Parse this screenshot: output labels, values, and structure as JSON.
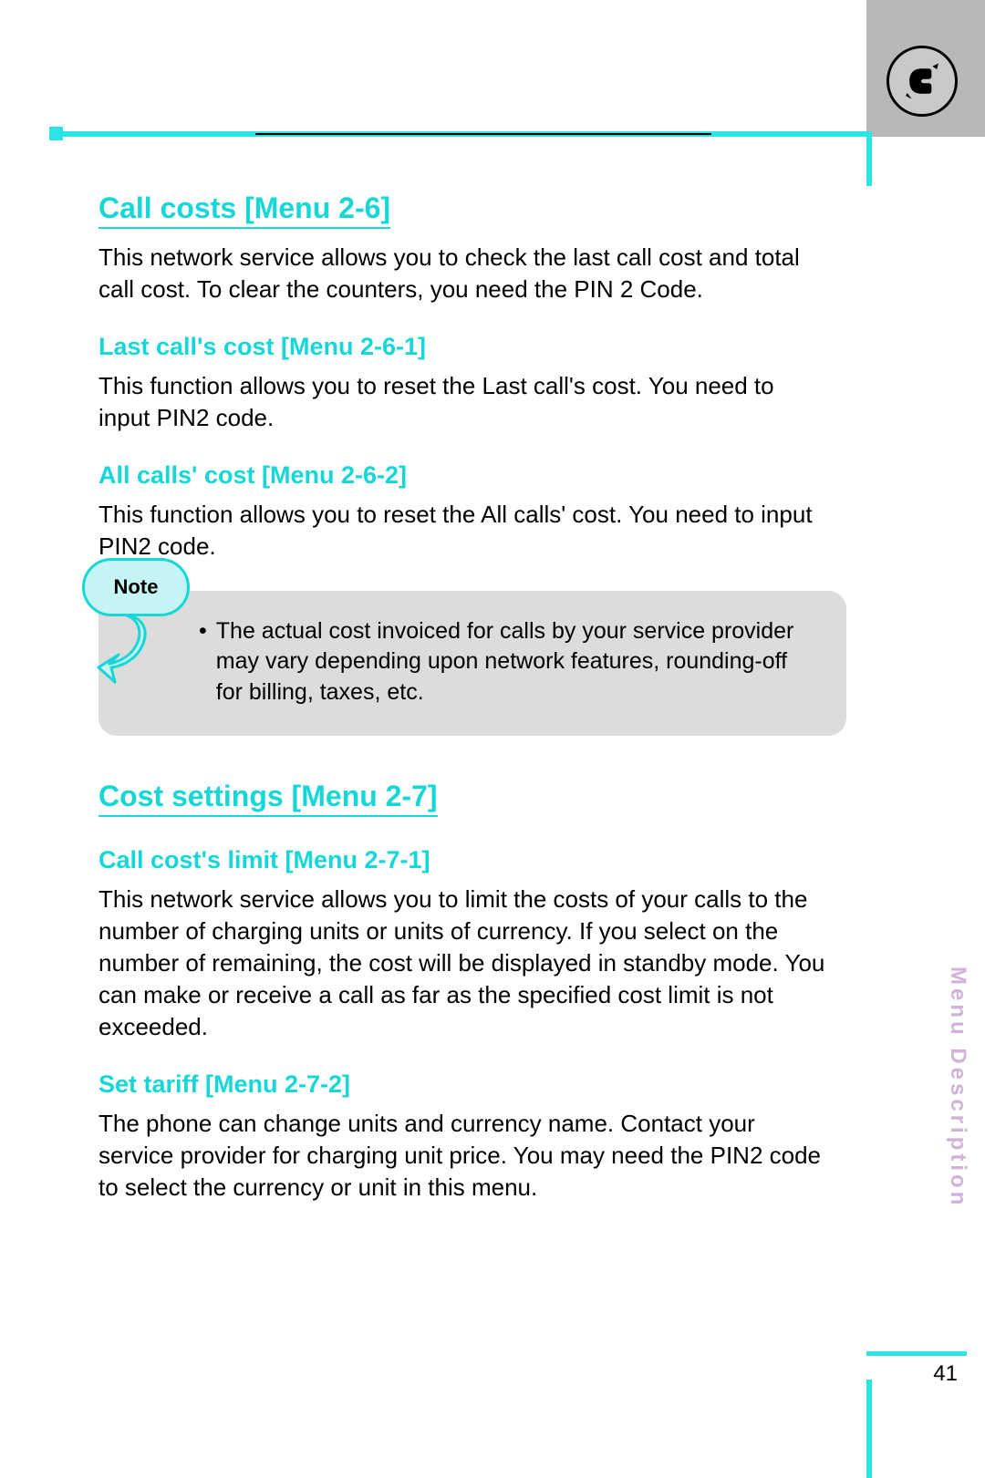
{
  "header": {
    "icon_name": "phone-handset-icon"
  },
  "sections": [
    {
      "heading": "Call costs [Menu 2-6]",
      "body": "This network service allows you to check the last call cost and total call cost. To clear the counters, you need the PIN 2 Code.",
      "subsections": [
        {
          "heading": "Last call's cost [Menu 2-6-1]",
          "body": "This function allows you to reset the Last call's cost. You need to input PIN2 code."
        },
        {
          "heading": "All calls' cost [Menu 2-6-2]",
          "body": "This function allows you to reset the All calls' cost. You need to input PIN2 code."
        }
      ]
    },
    {
      "heading": "Cost settings [Menu 2-7]",
      "body": "",
      "subsections": [
        {
          "heading": "Call cost's limit [Menu 2-7-1]",
          "body": "This network service allows you to limit the costs of your calls to the number of charging units or units of currency. If you select on the number of remaining, the cost will be displayed in standby mode. You can make or receive a call as far as the specified cost limit is not exceeded."
        },
        {
          "heading": "Set tariff [Menu 2-7-2]",
          "body": "The phone can change units and currency name. Contact your service provider for charging unit price. You may need the PIN2 code to select the currency or unit in this menu."
        }
      ]
    }
  ],
  "note": {
    "label": "Note",
    "text": "The actual cost invoiced for calls by your service provider may vary depending upon network features, rounding-off for billing, taxes, etc."
  },
  "side_label": "Menu Description",
  "page_number": "41"
}
